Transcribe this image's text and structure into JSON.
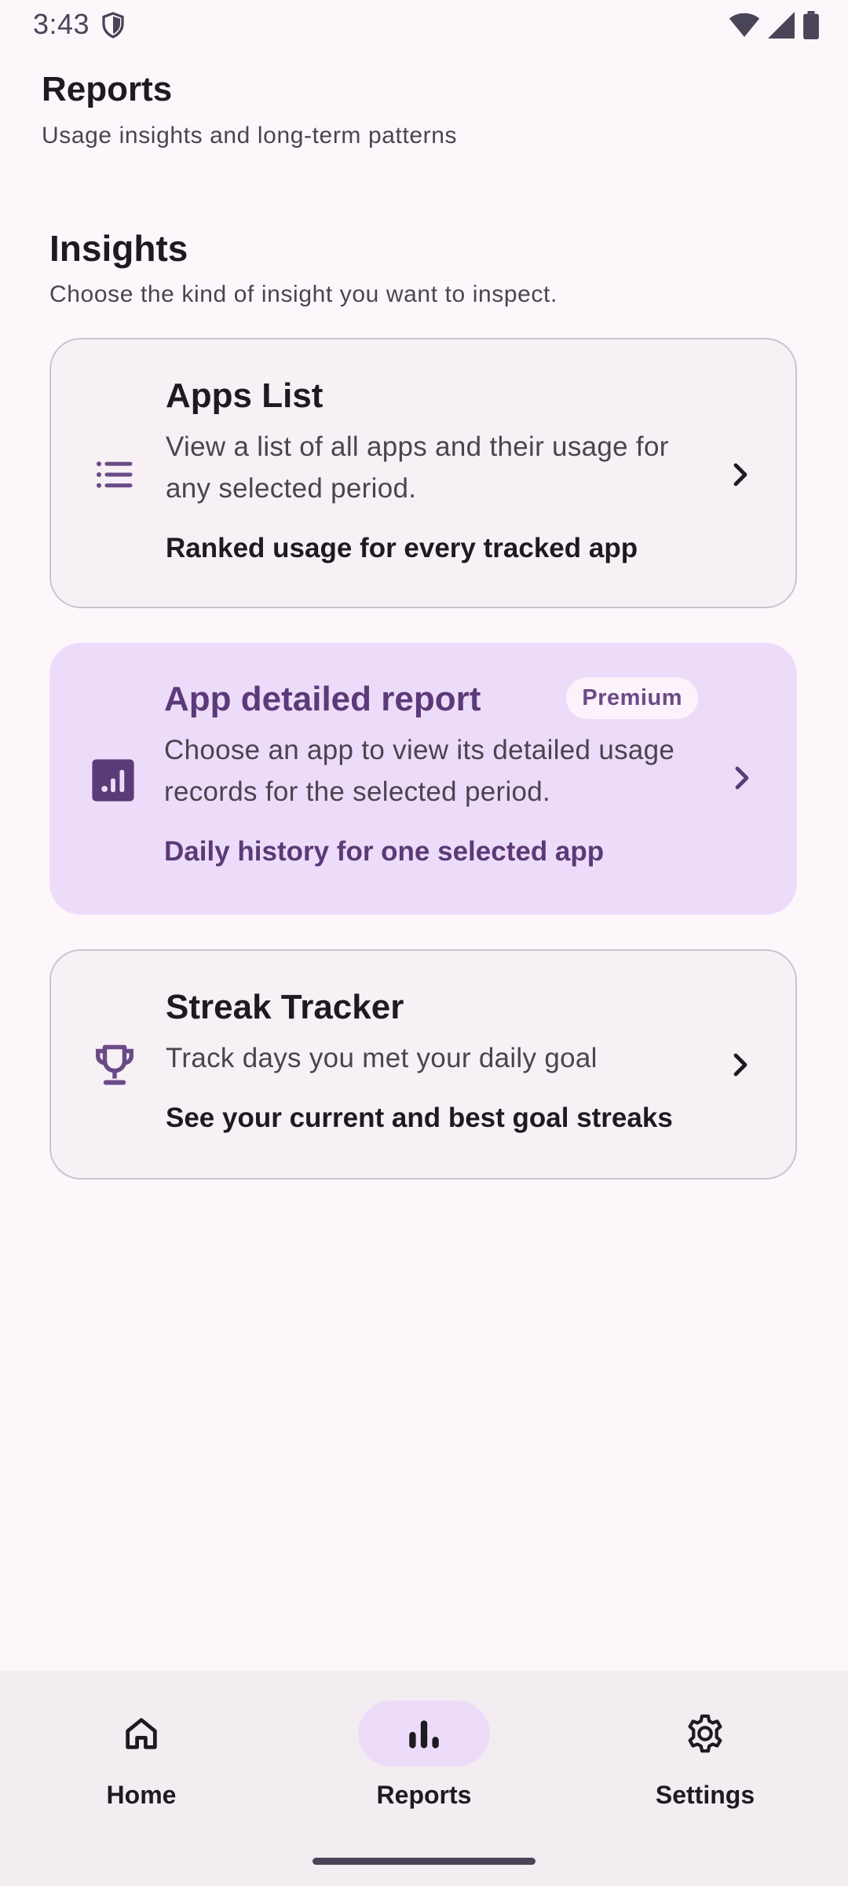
{
  "status_bar": {
    "time": "3:43"
  },
  "header": {
    "title": "Reports",
    "subtitle": "Usage insights and long-term patterns"
  },
  "section": {
    "title": "Insights",
    "subtitle": "Choose the kind of insight you want to inspect."
  },
  "cards": [
    {
      "icon": "list-icon",
      "title": "Apps List",
      "description": "View a list of all apps and their usage for any selected period.",
      "footer": "Ranked usage for every tracked app"
    },
    {
      "icon": "bar-chart-icon",
      "title": "App detailed report",
      "badge": "Premium",
      "description": "Choose an app to view its detailed usage records for the selected period.",
      "footer": "Daily history for one selected app"
    },
    {
      "icon": "trophy-icon",
      "title": "Streak Tracker",
      "description": "Track days you met your daily goal",
      "footer": "See your current and best goal streaks"
    }
  ],
  "bottom_nav": {
    "items": [
      {
        "label": "Home",
        "icon": "home-icon"
      },
      {
        "label": "Reports",
        "icon": "bar-chart-icon",
        "active": true
      },
      {
        "label": "Settings",
        "icon": "gear-icon"
      }
    ]
  },
  "colors": {
    "background": "#fdf7fc",
    "accent": "#5b3a78",
    "premium_card": "#eddcf9",
    "outlined_card": "#f7f1f6"
  }
}
